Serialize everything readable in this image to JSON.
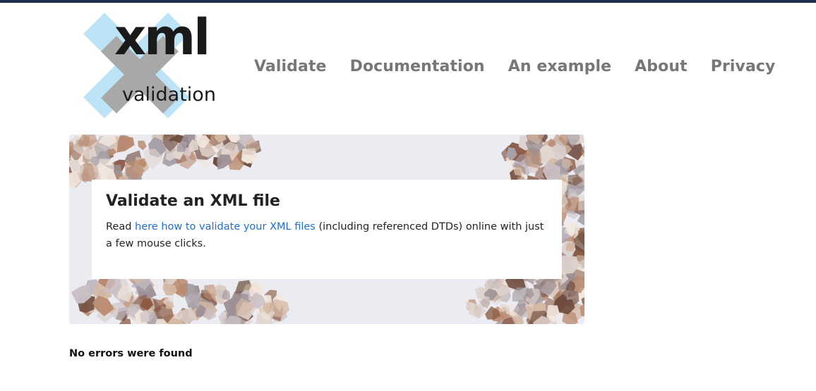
{
  "colors": {
    "top_bar": "#1b2f4a",
    "nav_text": "#777777",
    "link": "#1f6fd1",
    "logo_x_blue": "#bde3f6",
    "logo_x_gray": "#a8a8a8"
  },
  "logo": {
    "main": "xml",
    "sub": "validation"
  },
  "nav": {
    "items": [
      {
        "label": "Validate"
      },
      {
        "label": "Documentation"
      },
      {
        "label": "An example"
      },
      {
        "label": "About"
      },
      {
        "label": "Privacy"
      }
    ]
  },
  "hero": {
    "title": "Validate an XML file",
    "text_before": "Read ",
    "link_text": "here how to validate your XML files",
    "text_after": " (including referenced DTDs) online with just a few mouse clicks."
  },
  "status": {
    "message": "No errors were found"
  }
}
